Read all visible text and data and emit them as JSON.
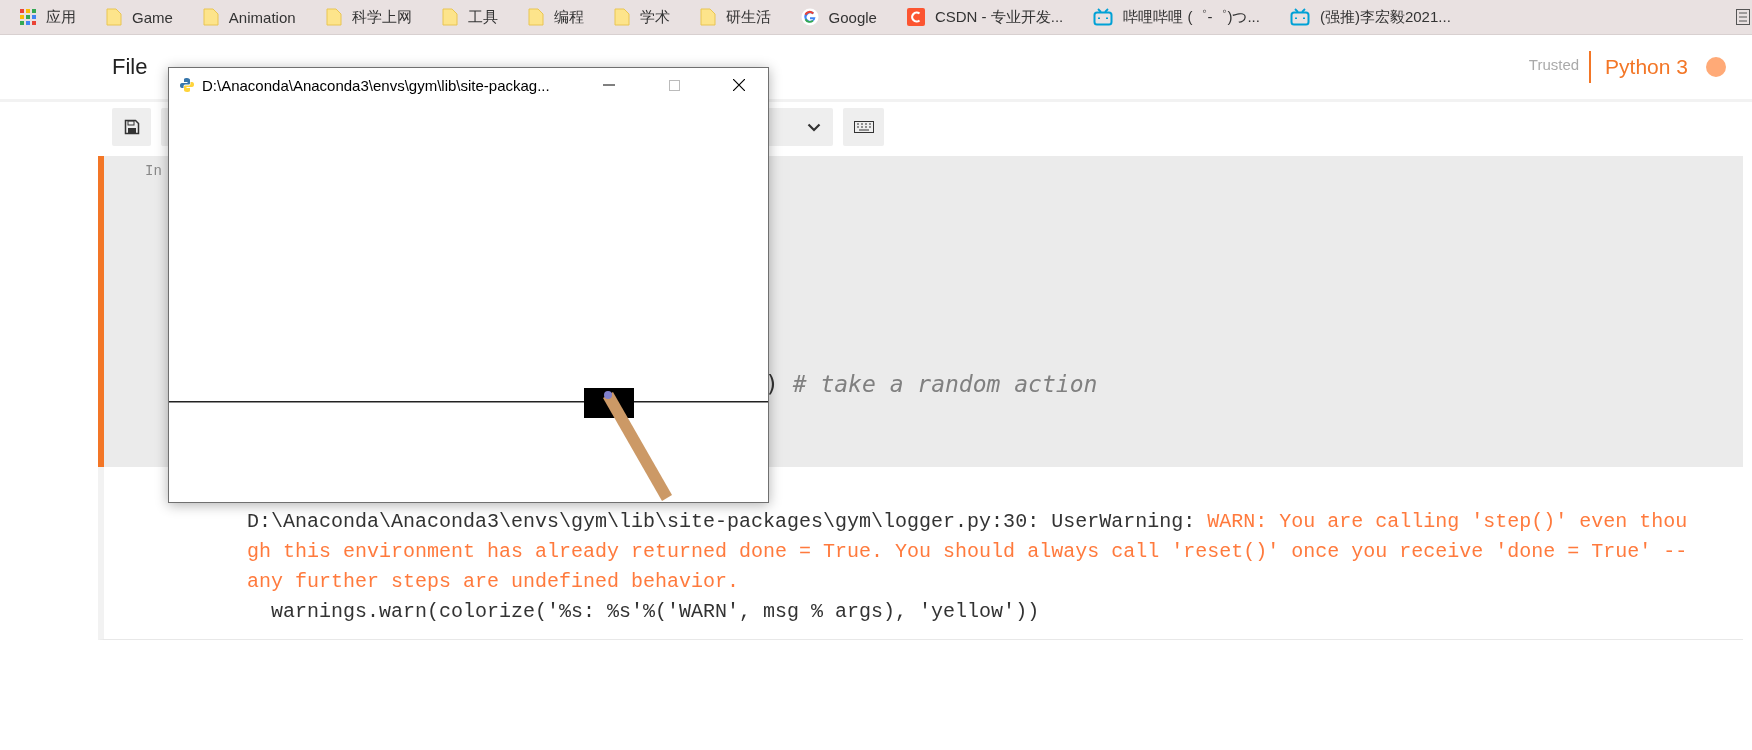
{
  "bookmarks": [
    {
      "label": "应用",
      "kind": "apps"
    },
    {
      "label": "Game",
      "kind": "folder"
    },
    {
      "label": "Animation",
      "kind": "folder"
    },
    {
      "label": "科学上网",
      "kind": "folder"
    },
    {
      "label": "工具",
      "kind": "folder"
    },
    {
      "label": "编程",
      "kind": "folder"
    },
    {
      "label": "学术",
      "kind": "folder"
    },
    {
      "label": "研生活",
      "kind": "folder"
    },
    {
      "label": "Google",
      "kind": "google"
    },
    {
      "label": "CSDN - 专业开发...",
      "kind": "csdn"
    },
    {
      "label": "哔哩哔哩 (゜-゜)つ...",
      "kind": "bilibili"
    },
    {
      "label": "(强推)李宏毅2021...",
      "kind": "bilibili"
    }
  ],
  "notebook": {
    "menu": [
      "File"
    ],
    "trusted": "Trusted",
    "kernel": "Python 3",
    "kernel_busy": true
  },
  "cell": {
    "prompt": "In",
    "selected": true,
    "code": [
      {
        "text": ")",
        "kind": "plain"
      },
      {
        "text": " # take a random action",
        "kind": "comment"
      }
    ]
  },
  "output": {
    "lines": [
      {
        "segments": [
          {
            "text": "D:\\Anaconda\\Anaconda3\\envs\\gym\\lib\\site-packages\\gym\\logger.py:30: UserWarning: ",
            "kind": "plain"
          },
          {
            "text": "WARN: You are calling 'step()' even thou",
            "kind": "warn"
          }
        ]
      },
      {
        "segments": [
          {
            "text": "gh this environment has already returned done = True. You should always call 'reset()' once you receive 'done = True' --",
            "kind": "warn"
          }
        ]
      },
      {
        "segments": [
          {
            "text": "any further steps are undefined behavior.",
            "kind": "warn"
          }
        ]
      },
      {
        "segments": [
          {
            "text": "  warnings.warn(colorize('%s: %s'%('WARN', msg % args), 'yellow'))",
            "kind": "plain"
          }
        ]
      }
    ]
  },
  "window": {
    "title": "D:\\Anaconda\\Anaconda3\\envs\\gym\\lib\\site-packag..."
  }
}
